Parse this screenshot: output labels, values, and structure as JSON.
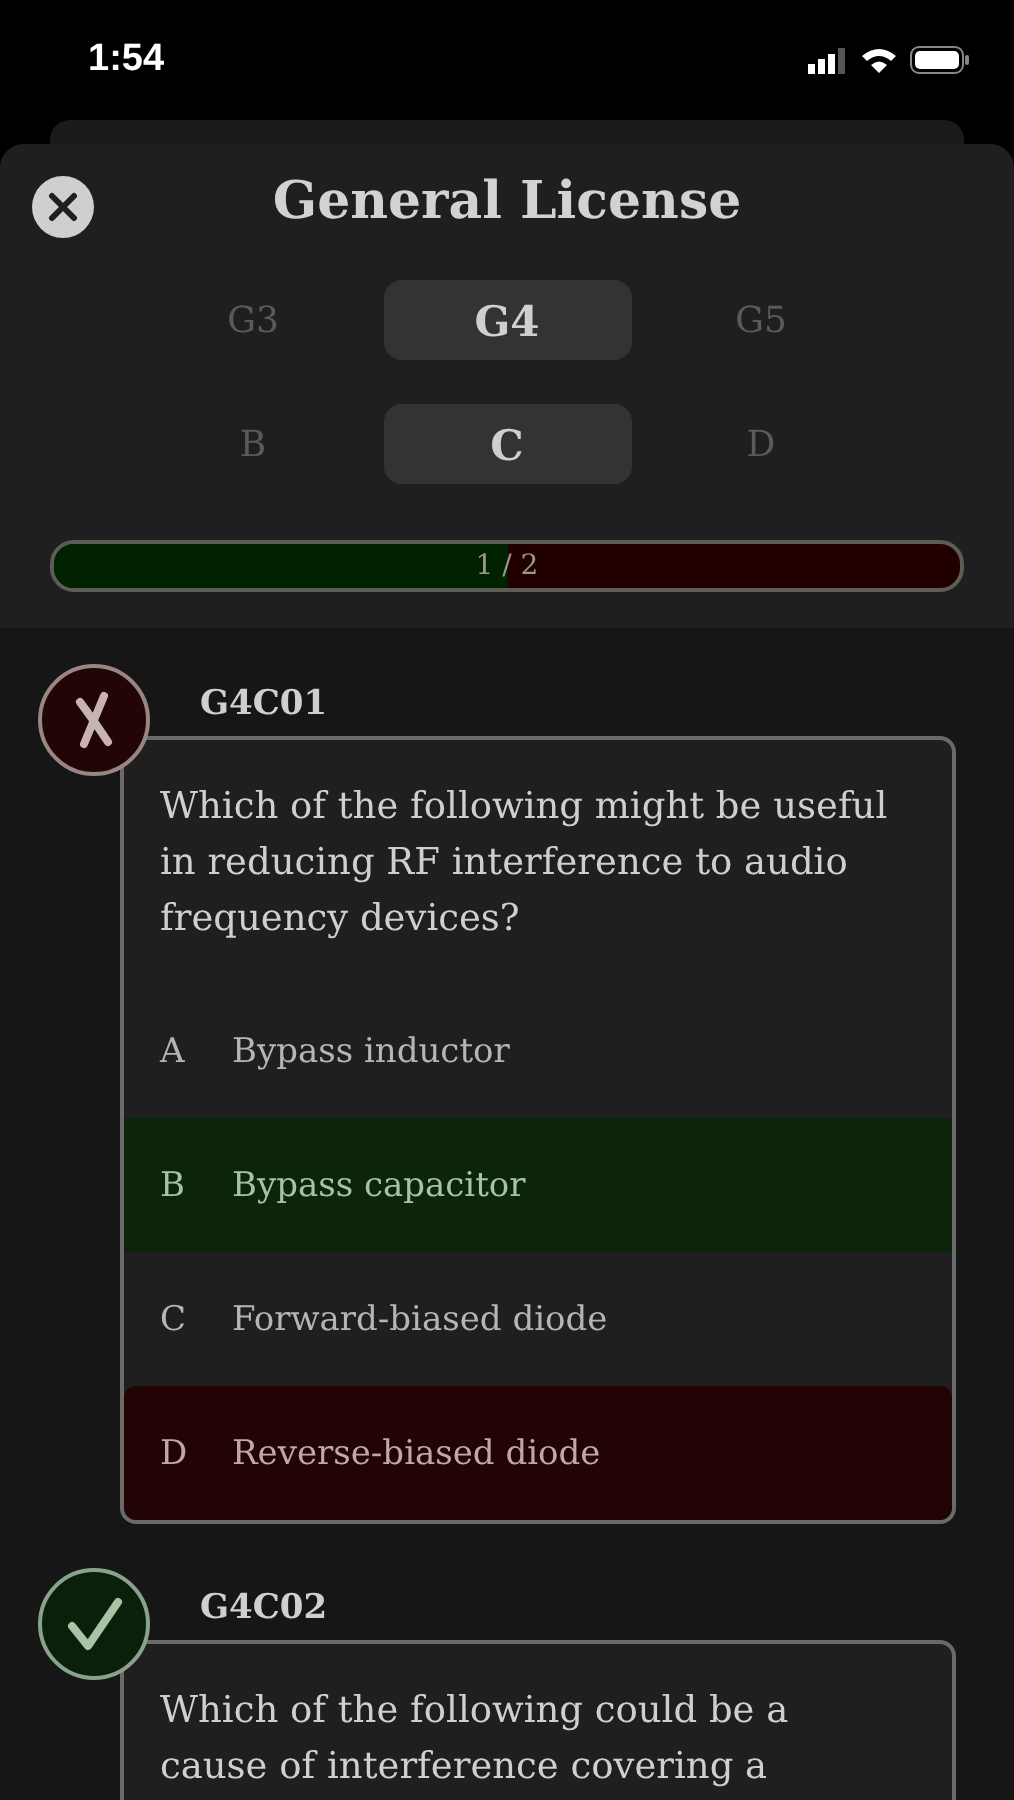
{
  "status_bar": {
    "time": "1:54"
  },
  "header": {
    "title": "General License"
  },
  "subelement_tabs": [
    {
      "label": "G3",
      "selected": false
    },
    {
      "label": "G4",
      "selected": true
    },
    {
      "label": "G5",
      "selected": false
    }
  ],
  "group_tabs": [
    {
      "label": "B",
      "selected": false
    },
    {
      "label": "C",
      "selected": true
    },
    {
      "label": "D",
      "selected": false
    }
  ],
  "progress": {
    "label": "1 / 2",
    "level": 0.5
  },
  "questions": [
    {
      "number": "G4C01",
      "answered_correctly": false,
      "text": "Which of the following might be useful in reducing RF interference to audio frequency devices?",
      "answers": [
        {
          "letter": "A",
          "text": "Bypass inductor",
          "correct": false,
          "chosen": false
        },
        {
          "letter": "B",
          "text": "Bypass capacitor",
          "correct": true,
          "chosen": false
        },
        {
          "letter": "C",
          "text": "Forward-biased diode",
          "correct": false,
          "chosen": false
        },
        {
          "letter": "D",
          "text": "Reverse-biased diode",
          "correct": false,
          "chosen": true
        }
      ]
    },
    {
      "number": "G4C02",
      "answered_correctly": true,
      "text": "Which of the following could be a cause of interference covering a"
    }
  ]
}
